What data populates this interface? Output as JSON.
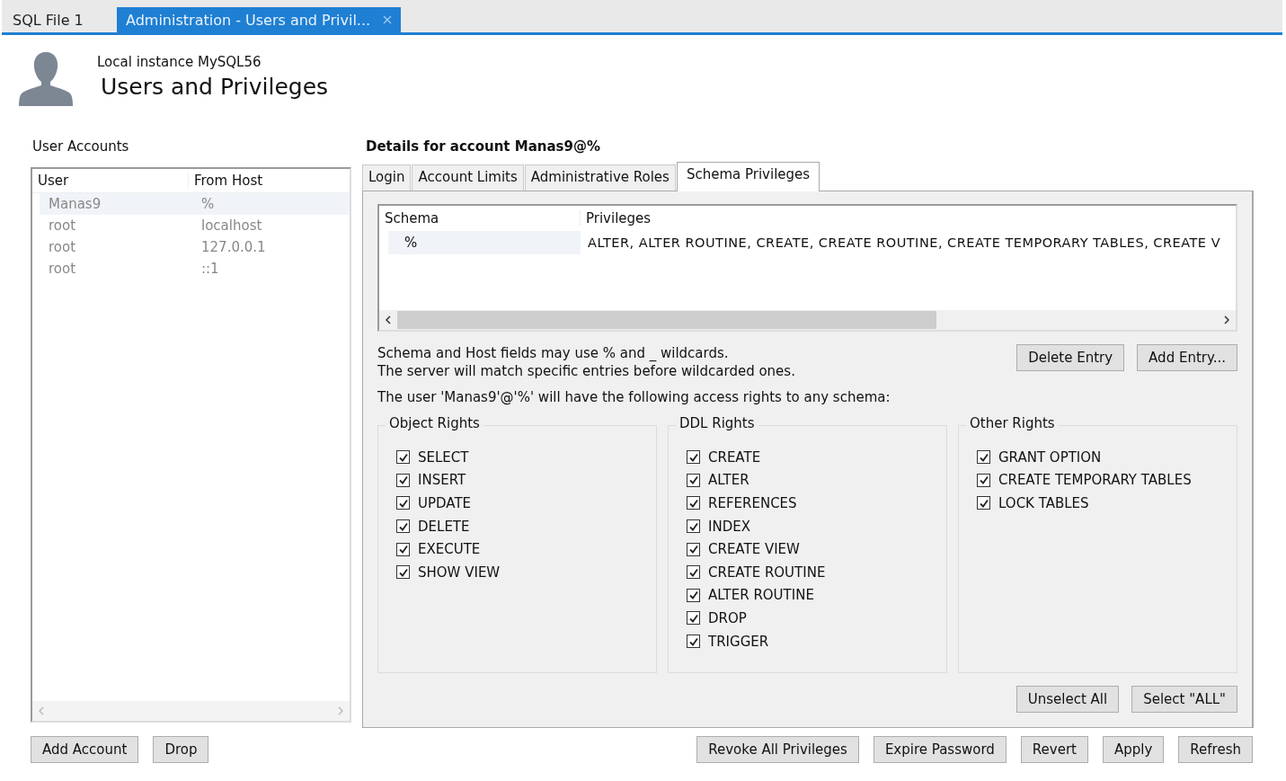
{
  "doc_tabs": [
    {
      "label": "SQL File 1",
      "selected": false
    },
    {
      "label": "Administration - Users and Privil...",
      "selected": true
    }
  ],
  "header": {
    "subtitle": "Local instance MySQL56",
    "title": "Users and Privileges"
  },
  "user_accounts": {
    "label": "User Accounts",
    "columns": [
      "User",
      "From Host"
    ],
    "rows": [
      {
        "user": "Manas9",
        "host": "%",
        "selected": true
      },
      {
        "user": "root",
        "host": "localhost",
        "selected": false
      },
      {
        "user": "root",
        "host": "127.0.0.1",
        "selected": false
      },
      {
        "user": "root",
        "host": "::1",
        "selected": false
      }
    ]
  },
  "details": {
    "title": "Details for account Manas9@%",
    "tabs": [
      {
        "label": "Login",
        "selected": false
      },
      {
        "label": "Account Limits",
        "selected": false
      },
      {
        "label": "Administrative Roles",
        "selected": false
      },
      {
        "label": "Schema Privileges",
        "selected": true
      }
    ],
    "schema_table": {
      "columns": [
        "Schema",
        "Privileges"
      ],
      "rows": [
        {
          "schema": "%",
          "privileges": "ALTER, ALTER ROUTINE, CREATE, CREATE ROUTINE, CREATE TEMPORARY TABLES, CREATE V"
        }
      ]
    },
    "hint_lines": [
      "Schema and Host fields may use % and _ wildcards.",
      "The server will match specific entries before wildcarded ones."
    ],
    "entry_buttons": [
      "Delete Entry",
      "Add Entry..."
    ],
    "access_note": "The user 'Manas9'@'%' will have the following access rights to any schema:",
    "groups": [
      {
        "title": "Object Rights",
        "items": [
          {
            "label": "SELECT",
            "checked": true
          },
          {
            "label": "INSERT",
            "checked": true
          },
          {
            "label": "UPDATE",
            "checked": true
          },
          {
            "label": "DELETE",
            "checked": true
          },
          {
            "label": "EXECUTE",
            "checked": true
          },
          {
            "label": "SHOW VIEW",
            "checked": true
          }
        ]
      },
      {
        "title": "DDL Rights",
        "items": [
          {
            "label": "CREATE",
            "checked": true
          },
          {
            "label": "ALTER",
            "checked": true
          },
          {
            "label": "REFERENCES",
            "checked": true
          },
          {
            "label": "INDEX",
            "checked": true
          },
          {
            "label": "CREATE VIEW",
            "checked": true
          },
          {
            "label": "CREATE ROUTINE",
            "checked": true
          },
          {
            "label": "ALTER ROUTINE",
            "checked": true
          },
          {
            "label": "DROP",
            "checked": true
          },
          {
            "label": "TRIGGER",
            "checked": true
          }
        ]
      },
      {
        "title": "Other Rights",
        "items": [
          {
            "label": "GRANT OPTION",
            "checked": true
          },
          {
            "label": "CREATE TEMPORARY TABLES",
            "checked": true
          },
          {
            "label": "LOCK TABLES",
            "checked": true
          }
        ]
      }
    ],
    "select_buttons": [
      "Unselect All",
      "Select \"ALL\""
    ]
  },
  "left_buttons": [
    "Add Account",
    "Drop"
  ],
  "right_buttons": [
    "Revoke All Privileges",
    "Expire Password",
    "Revert",
    "Apply",
    "Refresh"
  ]
}
